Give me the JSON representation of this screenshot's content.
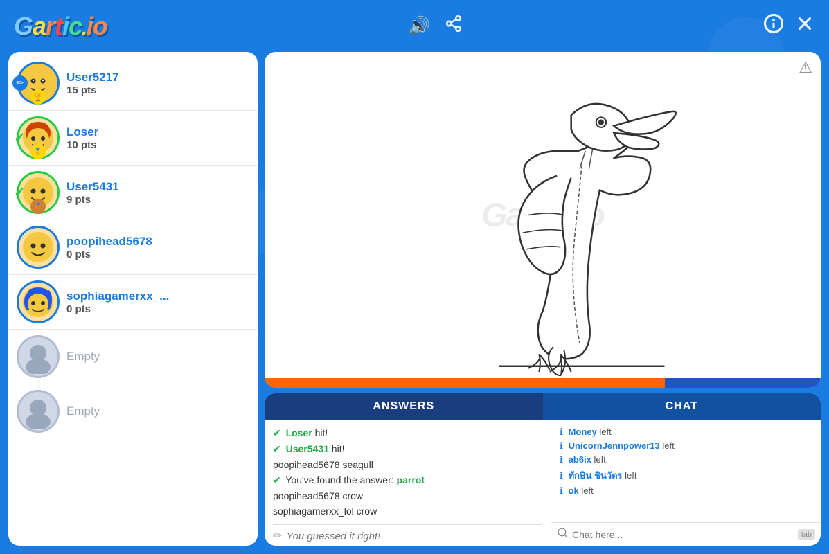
{
  "header": {
    "logo": "Gartic.io",
    "sound_btn": "🔊",
    "share_btn": "⋖",
    "info_btn": "ℹ",
    "close_btn": "✕"
  },
  "players": [
    {
      "id": "user5217",
      "name": "User5217",
      "pts": "15 pts",
      "is_drawing": true,
      "rank": "1",
      "rank_type": "gold",
      "guessed": false,
      "avatar_color": "yellow"
    },
    {
      "id": "loser",
      "name": "Loser",
      "pts": "10 pts",
      "is_drawing": false,
      "rank": "1",
      "rank_type": "gold",
      "guessed": true,
      "avatar_color": "orange"
    },
    {
      "id": "user5431",
      "name": "User5431",
      "pts": "9 pts",
      "is_drawing": false,
      "rank": "2",
      "rank_type": "bronze",
      "guessed": true,
      "avatar_color": "yellow"
    },
    {
      "id": "poopihead5678",
      "name": "poopihead5678",
      "pts": "0 pts",
      "is_drawing": false,
      "rank": "",
      "rank_type": "none",
      "guessed": false,
      "avatar_color": "yellow"
    },
    {
      "id": "sophiagamerxx",
      "name": "sophiagamerxx_...",
      "pts": "0 pts",
      "is_drawing": false,
      "rank": "",
      "rank_type": "none",
      "guessed": false,
      "avatar_color": "blue"
    },
    {
      "id": "empty1",
      "name": "Empty",
      "pts": "",
      "is_drawing": false,
      "is_empty": true
    },
    {
      "id": "empty2",
      "name": "Empty",
      "pts": "",
      "is_drawing": false,
      "is_empty": true
    }
  ],
  "canvas": {
    "watermark": "Gartic.io",
    "warning_icon": "⚠",
    "progress_pct": 72
  },
  "tabs": {
    "answers_label": "ANSWERS",
    "chat_label": "CHAT"
  },
  "answers": [
    {
      "user": "Loser",
      "correct": true,
      "text": "hit!"
    },
    {
      "user": "User5431",
      "correct": true,
      "text": "hit!"
    },
    {
      "user": "poopihead5678",
      "correct": false,
      "text": "seagull"
    },
    {
      "user": "You've found the answer:",
      "answer_word": "parrot",
      "is_answer": true
    },
    {
      "user": "poopihead5678",
      "correct": false,
      "text": "crow"
    },
    {
      "user": "sophiagamerxx_lol",
      "correct": false,
      "text": "crow"
    }
  ],
  "chat_messages": [
    {
      "user": "Money",
      "action": "left"
    },
    {
      "user": "UnicornJennpower13",
      "action": "left"
    },
    {
      "user": "ab6ix",
      "action": "left"
    },
    {
      "user": "ทักษิน ชินวัตร",
      "action": "left"
    },
    {
      "user": "ok",
      "action": "left"
    }
  ],
  "guess_input": {
    "placeholder": "You guessed it right!",
    "icon": "✏"
  },
  "chat_input": {
    "placeholder": "Chat here...",
    "tab_label": "tab",
    "icon": "🔍"
  }
}
